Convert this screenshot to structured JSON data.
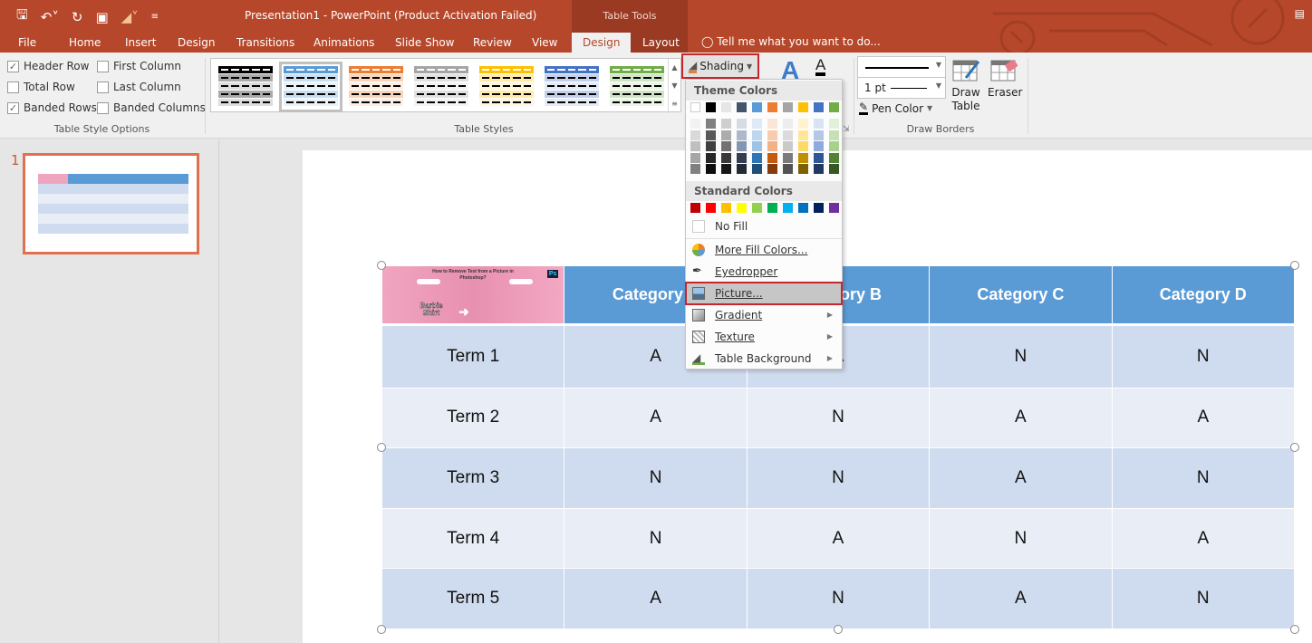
{
  "window": {
    "title": "Presentation1 - PowerPoint (Product Activation Failed)",
    "contextual_group": "Table Tools",
    "tell_me": "Tell me what you want to do..."
  },
  "qat": [
    "save-icon",
    "undo-icon",
    "redo-icon",
    "present-icon",
    "paint-bucket-icon",
    "customize-icon"
  ],
  "tabs": [
    {
      "label": "File"
    },
    {
      "label": "Home"
    },
    {
      "label": "Insert"
    },
    {
      "label": "Design"
    },
    {
      "label": "Transitions"
    },
    {
      "label": "Animations"
    },
    {
      "label": "Slide Show"
    },
    {
      "label": "Review"
    },
    {
      "label": "View"
    },
    {
      "label": "Design",
      "active": true
    },
    {
      "label": "Layout"
    }
  ],
  "ribbon": {
    "table_style_options": {
      "label": "Table Style Options",
      "options": [
        {
          "label": "Header Row",
          "checked": true
        },
        {
          "label": "First Column",
          "checked": false
        },
        {
          "label": "Total Row",
          "checked": false
        },
        {
          "label": "Last Column",
          "checked": false
        },
        {
          "label": "Banded Rows",
          "checked": true
        },
        {
          "label": "Banded Columns",
          "checked": false
        }
      ]
    },
    "table_styles": {
      "label": "Table Styles",
      "colors": [
        "#000000",
        "#5b9bd5",
        "#ed7d31",
        "#a5a5a5",
        "#ffc000",
        "#4472c4",
        "#70ad47"
      ],
      "selected_index": 1
    },
    "shading_label": "Shading",
    "draw_borders": {
      "label": "Draw Borders",
      "pen_weight": "1 pt",
      "pen_color": "Pen Color",
      "draw_table": "Draw Table",
      "eraser": "Eraser"
    }
  },
  "shading_menu": {
    "theme_colors_label": "Theme Colors",
    "theme_top": [
      "#ffffff",
      "#000000",
      "#e7e6e6",
      "#44546a",
      "#5b9bd5",
      "#ed7d31",
      "#a5a5a5",
      "#ffc000",
      "#4472c4",
      "#70ad47"
    ],
    "theme_shades": [
      [
        "#f2f2f2",
        "#d9d9d9",
        "#bfbfbf",
        "#a6a6a6",
        "#808080"
      ],
      [
        "#808080",
        "#595959",
        "#404040",
        "#262626",
        "#0d0d0d"
      ],
      [
        "#d0cece",
        "#aeabab",
        "#757171",
        "#3a3838",
        "#171616"
      ],
      [
        "#d6dce5",
        "#adb9ca",
        "#8497b0",
        "#333f50",
        "#222a35"
      ],
      [
        "#deebf7",
        "#bdd7ee",
        "#9dc3e6",
        "#2e75b6",
        "#1f4e79"
      ],
      [
        "#fbe5d6",
        "#f8cbad",
        "#f4b183",
        "#c55a11",
        "#843c0c"
      ],
      [
        "#ededed",
        "#dbdbdb",
        "#c9c9c9",
        "#7b7b7b",
        "#525252"
      ],
      [
        "#fff2cc",
        "#ffe699",
        "#ffd966",
        "#bf9000",
        "#7f6000"
      ],
      [
        "#dae3f3",
        "#b4c7e7",
        "#8faadc",
        "#2f5597",
        "#203864"
      ],
      [
        "#e2f0d9",
        "#c5e0b4",
        "#a9d18e",
        "#548235",
        "#385723"
      ]
    ],
    "standard_colors_label": "Standard Colors",
    "standard": [
      "#c00000",
      "#ff0000",
      "#ffc000",
      "#ffff00",
      "#92d050",
      "#00b050",
      "#00b0f0",
      "#0070c0",
      "#002060",
      "#7030a0"
    ],
    "no_fill": "No Fill",
    "more_fill": "More Fill Colors...",
    "eyedropper": "Eyedropper",
    "picture": "Picture...",
    "gradient": "Gradient",
    "texture": "Texture",
    "table_background": "Table Background"
  },
  "slides": {
    "number": "1"
  },
  "table": {
    "header_image_text": "How to Remove Text from a Picture in Photoshop?",
    "header_image_caption": "Barbie Shirt",
    "headers": [
      "Category A",
      "Category B",
      "Category C",
      "Category D"
    ],
    "rows": [
      {
        "term": "Term 1",
        "values": [
          "A",
          "A",
          "N",
          "N"
        ]
      },
      {
        "term": "Term 2",
        "values": [
          "A",
          "N",
          "A",
          "A"
        ]
      },
      {
        "term": "Term 3",
        "values": [
          "N",
          "N",
          "A",
          "N"
        ]
      },
      {
        "term": "Term 4",
        "values": [
          "N",
          "A",
          "N",
          "A"
        ]
      },
      {
        "term": "Term 5",
        "values": [
          "A",
          "N",
          "A",
          "N"
        ]
      }
    ]
  }
}
